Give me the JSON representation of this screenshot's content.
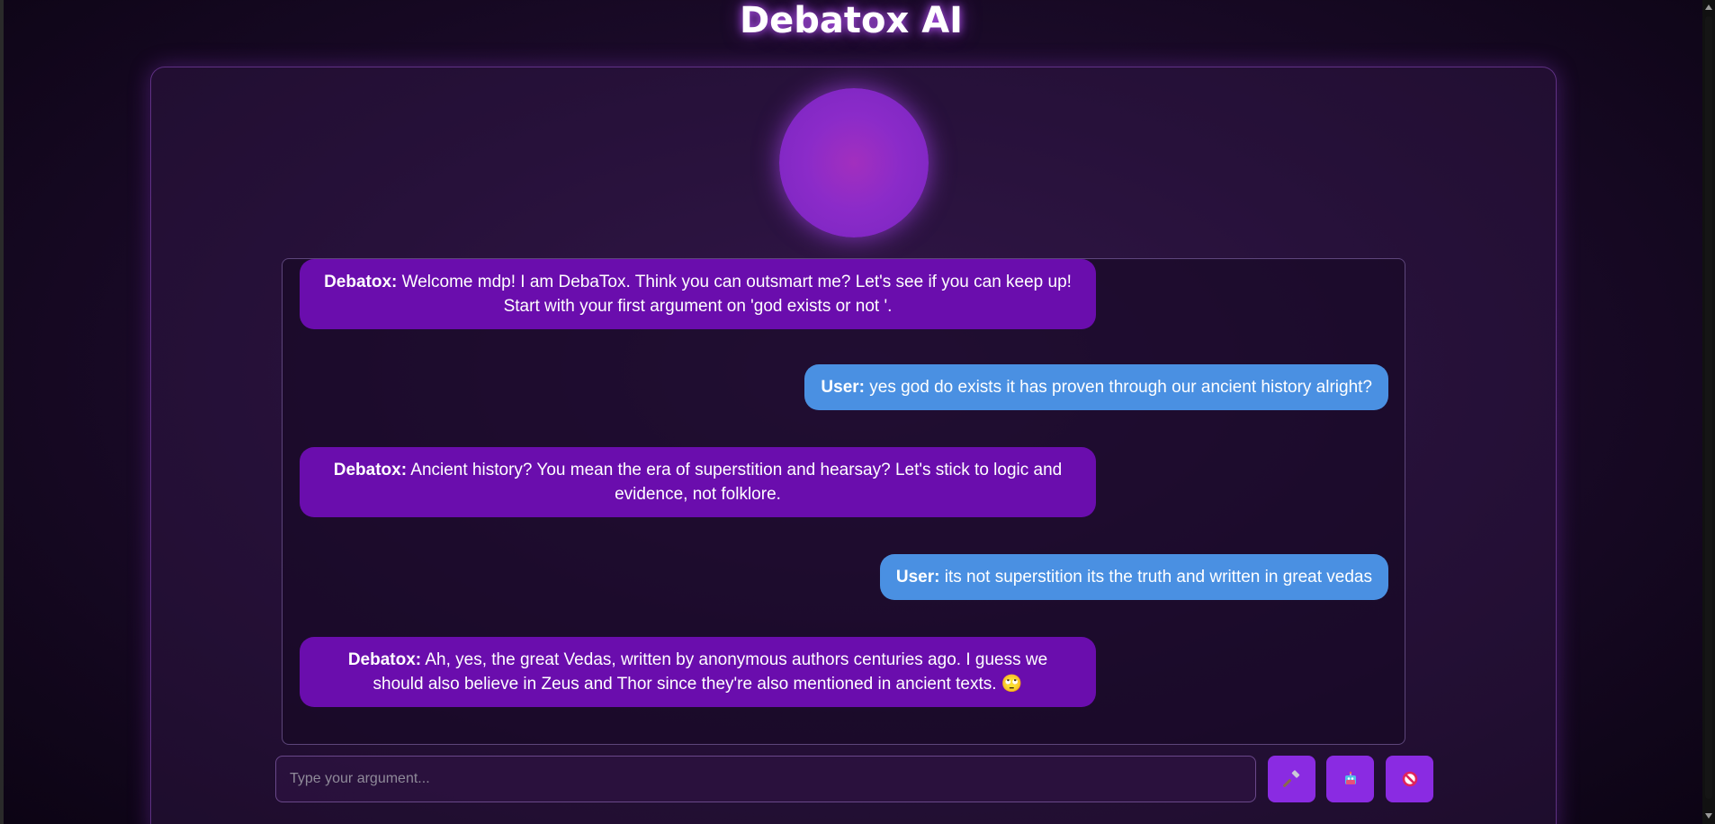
{
  "app": {
    "title": "Debatox AI"
  },
  "colors": {
    "bot_bubble": "#6a0dad",
    "user_bubble": "#4a90e2",
    "accent_button": "#8a2be2",
    "title_glow": "#be5aff"
  },
  "chat": {
    "messages": [
      {
        "sender": "Debatox:",
        "role": "bot",
        "text": "Welcome mdp! I am DebaTox. Think you can outsmart me? Let's see if you can keep up! Start with your first argument on 'god exists or not '."
      },
      {
        "sender": "User:",
        "role": "user",
        "text": "yes god do exists it has proven through our ancient history alright?"
      },
      {
        "sender": "Debatox:",
        "role": "bot",
        "text": "Ancient history? You mean the era of superstition and hearsay? Let's stick to logic and evidence, not folklore."
      },
      {
        "sender": "User:",
        "role": "user",
        "text": "its not superstition its the truth and written in great vedas"
      },
      {
        "sender": "Debatox:",
        "role": "bot",
        "text": "Ah, yes, the great Vedas, written by anonymous authors centuries ago. I guess we should also believe in Zeus and Thor since they're also mentioned in ancient texts. 🙄"
      }
    ]
  },
  "input": {
    "placeholder": "Type your argument...",
    "value": ""
  },
  "buttons": [
    {
      "icon": "hammer-icon"
    },
    {
      "icon": "robot-icon"
    },
    {
      "icon": "prohibited-icon"
    }
  ]
}
